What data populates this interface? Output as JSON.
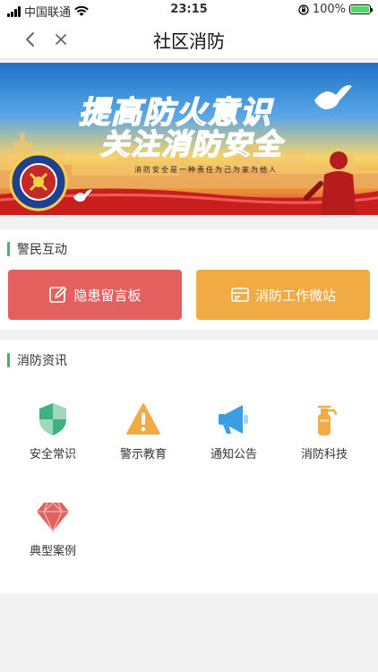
{
  "status_bar": {
    "carrier": "中国联通",
    "time": "23:15",
    "battery": "100%",
    "battery_level": 1.0
  },
  "nav": {
    "title": "社区消防"
  },
  "banner": {
    "line1": "提高防火意识",
    "line2": "关注消防安全",
    "slogan": "消防安全是一种责任为己为家为他人"
  },
  "sections": {
    "interaction": {
      "title": "警民互动",
      "buttons": [
        {
          "label": "隐患留言板",
          "icon": "edit-icon",
          "color": "#e2605e"
        },
        {
          "label": "消防工作微站",
          "icon": "card-icon",
          "color": "#f0ab44"
        }
      ]
    },
    "news": {
      "title": "消防资讯",
      "items": [
        {
          "label": "安全常识",
          "icon": "shield-icon",
          "color": "#3fb37f"
        },
        {
          "label": "警示教育",
          "icon": "warning-icon",
          "color": "#f0ab44"
        },
        {
          "label": "通知公告",
          "icon": "megaphone-icon",
          "color": "#3a9ee4"
        },
        {
          "label": "消防科技",
          "icon": "extinguisher-icon",
          "color": "#f0ab44"
        },
        {
          "label": "典型案例",
          "icon": "diamond-icon",
          "color": "#e2605e"
        }
      ]
    }
  },
  "colors": {
    "accent_green": "#43b36f",
    "red": "#e2605e",
    "orange": "#f0ab44"
  }
}
